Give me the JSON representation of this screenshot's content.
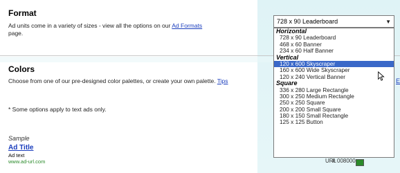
{
  "format": {
    "title": "Format",
    "description": "Ad units come in a variety of sizes - view all the options on our",
    "link": "Ad Formats",
    "trailing": "page."
  },
  "colors": {
    "title": "Colors",
    "description": "Choose from one of our pre-designed color palettes, or create your own palette.",
    "link": "Tips",
    "note": "* Some options apply to text ads only."
  },
  "sample": {
    "label": "Sample",
    "ad_title": "Ad Title",
    "ad_text": "Ad text",
    "ad_url": "www.ad-url.com"
  },
  "select": {
    "value": "728 x 90 Leaderboard",
    "groups": [
      {
        "name": "Horizontal",
        "options": [
          "728 x 90 Leaderboard",
          "468 x 60 Banner",
          "234 x 60 Half Banner"
        ]
      },
      {
        "name": "Vertical",
        "options": [
          "120 x 600 Skyscraper",
          "160 x 600 Wide Skyscraper",
          "120 x 240 Vertical Banner"
        ]
      },
      {
        "name": "Square",
        "options": [
          "336 x 280 Large Rectangle",
          "300 x 250 Medium Rectangle",
          "250 x 250 Square",
          "200 x 200 Small Square",
          "180 x 150 Small Rectangle",
          "125 x 125 Button"
        ]
      }
    ],
    "highlighted": "120 x 600 Skyscraper"
  },
  "fragments": {
    "right_link": "Ed",
    "url_label": "URL",
    "hash": "#",
    "hex": "008000",
    "swatch_color": "#2a8a2a"
  }
}
